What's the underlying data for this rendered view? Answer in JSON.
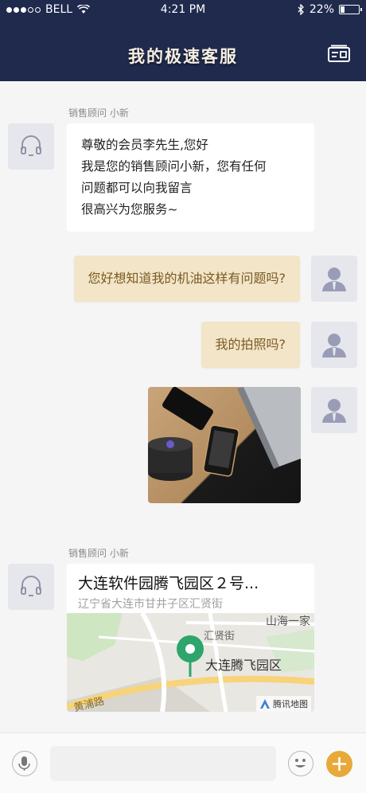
{
  "status_bar": {
    "carrier": "BELL",
    "time": "4:21 PM",
    "battery": "22%",
    "battery_level": 0.22
  },
  "header": {
    "title": "我的极速客服",
    "card_icon": "contact-card-icon"
  },
  "messages": [
    {
      "side": "left",
      "sender": "销售顾问 小新",
      "lines": [
        "尊敬的会员李先生,您好",
        "我是您的销售顾问小新，您有任何",
        "问题都可以向我留言",
        "很高兴为您服务~"
      ]
    },
    {
      "side": "right",
      "text": "您好想知道我的机油这样有问题吗?"
    },
    {
      "side": "right",
      "text": "我的拍照吗?"
    },
    {
      "side": "right",
      "type": "image",
      "icon": "product-photo"
    },
    {
      "side": "left",
      "sender": "销售顾问 小新",
      "type": "location",
      "location": {
        "title": "大连软件园腾飞园区２号...",
        "address": "辽宁省大连市甘井子区汇贤街",
        "map_labels": {
          "area": "大连腾飞园区",
          "street": "汇贤街",
          "nearby": "山海一家",
          "road": "黄浦路",
          "provider": "腾讯地图"
        }
      }
    }
  ],
  "input_bar": {
    "placeholder": "",
    "voice_icon": "microphone-icon",
    "emoji_icon": "emoji-icon",
    "add_icon": "plus-icon"
  },
  "colors": {
    "header_bg": "#1f2a4d",
    "bubble_right": "#f2e5c8",
    "accent": "#e8a93a"
  }
}
